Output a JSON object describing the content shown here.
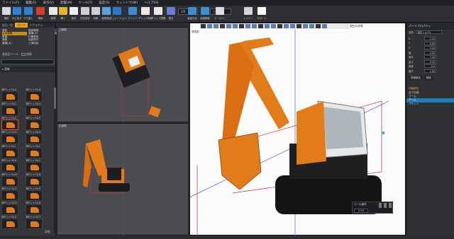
{
  "menu": [
    "ファイル(F)",
    "編集(E)",
    "表示(V)",
    "配置(M)",
    "ツール(T)",
    "設定(S)",
    "ウィンドウ(W)",
    "ヘルプ(H)"
  ],
  "ribbon": {
    "buttons": [
      {
        "label": "選択",
        "color": "#d8d8d8"
      },
      {
        "label": "元に戻す",
        "color": "#2f7fd2"
      },
      {
        "label": "やり直し",
        "color": "#2f7fd2"
      },
      {
        "label": "削除",
        "color": "#d93a2c"
      },
      {
        "label": "新規",
        "color": "#e8e8e8"
      },
      {
        "label": "開く",
        "color": "#e8b424"
      },
      {
        "label": "保存",
        "color": "#eeeeee"
      },
      {
        "label": "別名保存",
        "color": "#cfcfcf"
      },
      {
        "label": "印刷",
        "color": "#d0d0d0"
      },
      {
        "label": "画像書出",
        "color": "#5aa4dc"
      },
      {
        "label": "シミュレーション",
        "color": "#2b78c8"
      },
      {
        "label": "グリッド",
        "color": "#3a8fd4"
      },
      {
        "label": "グリッド吸着",
        "color": "#e9e9e9"
      },
      {
        "label": "グリッド間隔",
        "color": "#e9e9e9"
      },
      {
        "label": "視点",
        "color": "#6a7bd1"
      },
      {
        "label": "画面分割",
        "color": "#3a8fd4"
      },
      {
        "label": "画面移動",
        "color": "#3a8fd4"
      },
      {
        "label": "ツールバー",
        "color": "#dddddd"
      },
      {
        "label": "レイヤー",
        "color": "#d4d4d4"
      },
      {
        "label": "サポート",
        "color": "#ffffff"
      }
    ],
    "selects": [
      "1/5",
      "三面図"
    ]
  },
  "left_panel": {
    "tabs": [
      "部品一覧",
      "パーツ",
      "テクスチャ"
    ],
    "tree": [
      "建設",
      "土木建機",
      "重機",
      "道路",
      "重機(大)",
      "建設機械",
      "重機(小)",
      "作業車両",
      "仮設資材",
      "工事用品",
      "その他",
      "現場小物"
    ],
    "tree_highlight": "土木建機",
    "filter_label": "各部品ツール",
    "filter_value": "階層",
    "section": "重機",
    "items": [
      "油圧ショベルA",
      "油圧ショベルB",
      "油圧ショベルC",
      "油圧ショベルD",
      "油圧ショベルE",
      "油圧ショベルF",
      "油圧ショベルG",
      "油圧ショベルH",
      "油圧ショベルI",
      "油圧ショベルJ",
      "油圧ショベルK",
      "油圧ショベルL",
      "油圧ショベルM",
      "油圧ショベルN",
      "油圧ショベルO",
      "油圧ショベルP",
      "油圧ショベルQ",
      "油圧ショベルR",
      "油圧ショベルS",
      "油圧ショベルT"
    ],
    "footer": "詳細"
  },
  "viewports": {
    "top": "上面図",
    "front": "正面図",
    "perspective": "透視図",
    "status": "現在の状態"
  },
  "properties": {
    "title": "パーツプロパティ",
    "name_label": "名前",
    "name_value": "油圧ショベル",
    "rows": [
      {
        "label": "X",
        "value": "1.25"
      },
      {
        "label": "Y",
        "value": "0.00"
      },
      {
        "label": "Z",
        "value": "2.10"
      },
      {
        "label": "幅",
        "value": "3.50"
      },
      {
        "label": "奥行",
        "value": "7.20"
      },
      {
        "label": "高さ",
        "value": "3.10"
      },
      {
        "label": "角度",
        "value": "0.0"
      },
      {
        "label": "縮尺",
        "value": "1.00"
      }
    ],
    "tab1": "詳細設定",
    "tab2": "削除",
    "vis_title": "可動部位",
    "vis_items": [
      "全て可視",
      "ブーム",
      "アーム",
      "バケット"
    ],
    "vis_highlight": "アーム"
  },
  "control": {
    "title": "ツール操作",
    "value": "0.00"
  }
}
